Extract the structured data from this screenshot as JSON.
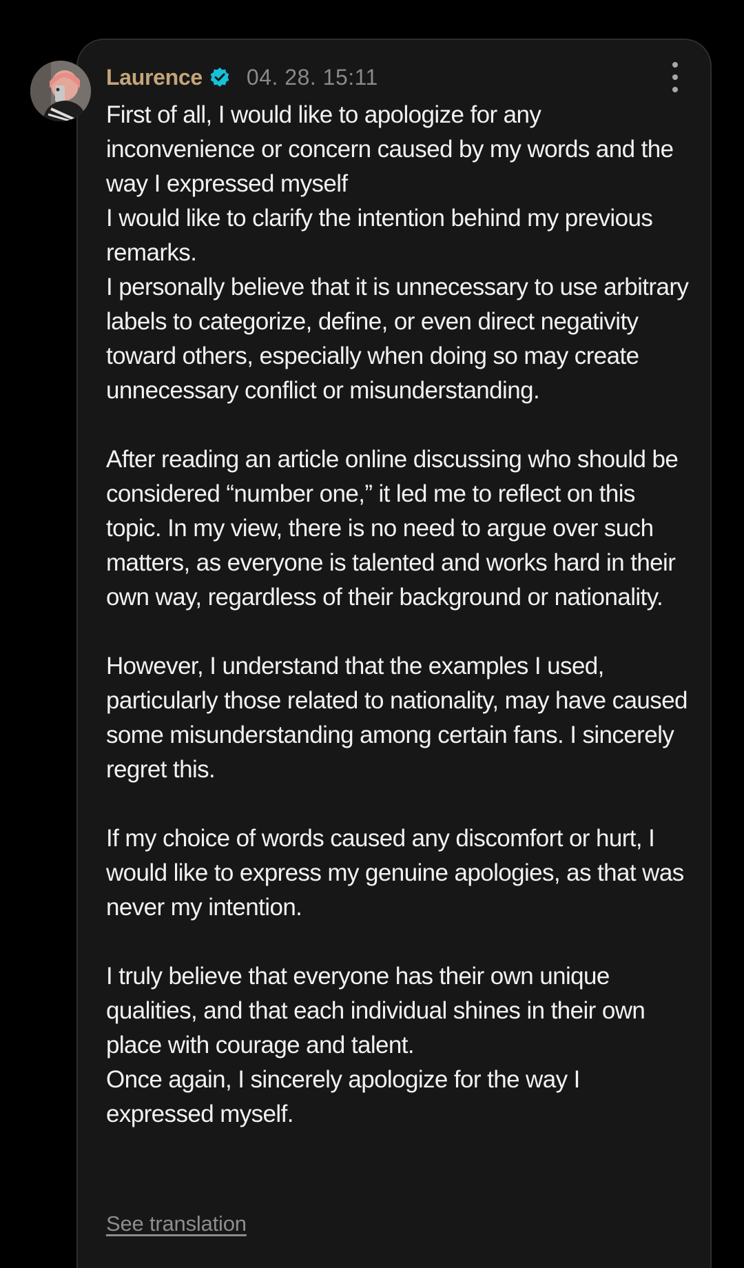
{
  "comment": {
    "username": "Laurence",
    "timestamp": "04. 28. 15:11",
    "paragraphs": [
      "First of all, I would like to apologize for any inconvenience or concern caused by my words and the way I expressed myself\nI would like to clarify the intention behind my previous remarks.\nI personally believe that it is unnecessary to use arbitrary labels to categorize, define, or even direct negativity toward others, especially when doing so may create unnecessary conflict or misunderstanding.",
      "After reading an article online discussing who should be considered “number one,” it led me to reflect on this topic. In my view, there is no need to argue over such matters, as everyone is talented and works hard in their own way, regardless of their background or nationality.",
      "However, I understand that the examples I used, particularly those related to nationality, may have caused some misunderstanding among certain fans. I sincerely regret this.",
      "If my choice of words caused any discomfort or hurt, I would like to express my genuine apologies, as that was never my intention.",
      "I truly believe that everyone has their own unique qualities, and that each individual shines in their own place with courage and talent.\nOnce again, I sincerely apologize for the way I expressed myself."
    ],
    "see_translation_label": "See translation"
  },
  "icons": {
    "verified": "verified-badge-icon",
    "more": "more-vertical-icon"
  },
  "colors": {
    "background": "#000000",
    "card": "#171717",
    "username": "#c4a57a",
    "verified_badge": "#16c1d8",
    "timestamp": "#8a8a8a",
    "text": "#f2f2f2",
    "link": "#8d8d8d"
  }
}
